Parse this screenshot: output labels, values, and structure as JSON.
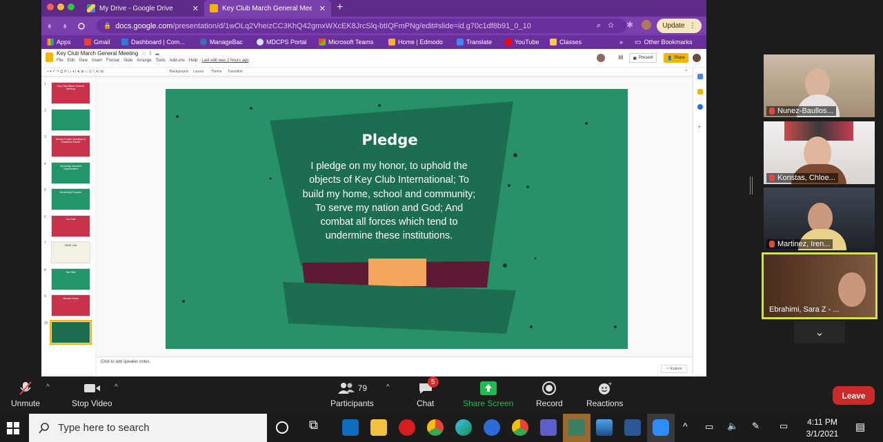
{
  "browser": {
    "tabs": [
      {
        "title": "My Drive - Google Drive",
        "close": "✕"
      },
      {
        "title": "Key Club March General Meeting - Google Slides",
        "close": "✕"
      }
    ],
    "new_tab": "+",
    "url_host": "docs.google.com",
    "url_path": "/presentation/d/1wOLq2VheizCC3KhQ42gmxWXcEK8JrcSlq-btIQFmPNg/edit#slide=id.g70c1df8b91_0_10",
    "update_label": "Update",
    "bookmarks": [
      "Apps",
      "Gmail",
      "Dashboard | Com...",
      "ManageBac",
      "MDCPS Portal",
      "Microsoft Teams",
      "Home | Edmodo",
      "Translate",
      "YouTube",
      "Classes"
    ],
    "other_bookmarks": "Other Bookmarks",
    "bookmarks_more": "»"
  },
  "slides_app": {
    "doc_title": "Key Club March General Meeting",
    "menus": [
      "File",
      "Edit",
      "View",
      "Insert",
      "Format",
      "Slide",
      "Arrange",
      "Tools",
      "Add-ons",
      "Help"
    ],
    "last_edit": "Last edit was 2 hours ago",
    "present_label": "Present",
    "share_label": "Share",
    "toolbar_items": [
      "Background",
      "Layout",
      "Theme",
      "Transition"
    ],
    "speaker_notes": "Click to add speaker notes",
    "explore_label": "Explore",
    "thumbnail_numbers": [
      "1",
      "2",
      "3",
      "4",
      "5",
      "6",
      "7",
      "8",
      "9",
      "10"
    ],
    "thumbnail_texts": [
      "Key Club March General Meeting",
      "",
      "Service Project Questions & Donations Advice",
      "Upcoming Volunteer Opportunities",
      "Mentorship Program",
      "Fun Fact",
      "SNHS Club",
      "Title Slide",
      "Service Hours",
      ""
    ]
  },
  "slide": {
    "title": "Pledge",
    "body": "I pledge on my honor, to uphold the objects of Key Club International; To build my home, school and community; To serve my nation and God; And combat all forces which tend to undermine these institutions."
  },
  "participants": [
    {
      "name": "Nunez-Baullos..."
    },
    {
      "name": "Konstas, Chloe..."
    },
    {
      "name": "Martinez, Iren..."
    },
    {
      "name": "Ebrahimi, Sara Z - ..."
    }
  ],
  "zoom": {
    "unmute": "Unmute",
    "stop_video": "Stop Video",
    "participants": "Participants",
    "participant_count": "79",
    "chat": "Chat",
    "chat_badge": "5",
    "share_screen": "Share Screen",
    "record": "Record",
    "reactions": "Reactions",
    "leave": "Leave"
  },
  "taskbar": {
    "search_placeholder": "Type here to search",
    "time": "4:11 PM",
    "date": "3/1/2021"
  },
  "colors": {
    "chrome_purple": "#7b3fae",
    "slide_green": "#279169",
    "hat_dark": "#1b6e4f",
    "hat_band": "#5c1a34",
    "buckle": "#f4a65c",
    "leave_red": "#cb2a2a",
    "share_green": "#1fbb53"
  }
}
